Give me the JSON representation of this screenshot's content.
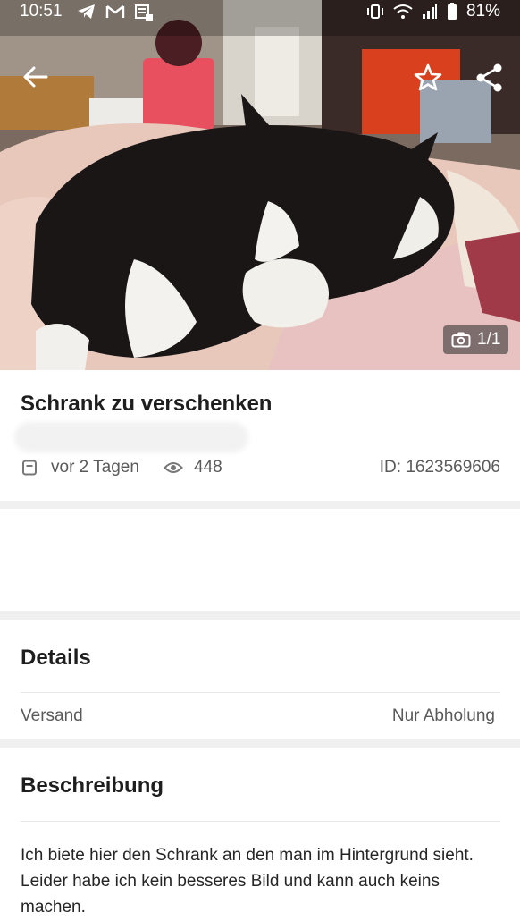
{
  "status_bar": {
    "time": "10:51",
    "left_icons": [
      "telegram-icon",
      "gmail-icon",
      "news-icon"
    ],
    "right_icons": [
      "vibrate-icon",
      "wifi-icon",
      "signal-icon",
      "battery-icon"
    ],
    "battery": "81%"
  },
  "photo": {
    "counter": "1/1"
  },
  "listing": {
    "title": "Schrank zu verschenken",
    "date": "vor 2 Tagen",
    "views": "448",
    "id_label": "ID: 1623569606"
  },
  "details": {
    "heading": "Details",
    "rows": [
      {
        "key": "Versand",
        "value": "Nur Abholung"
      }
    ]
  },
  "description": {
    "heading": "Beschreibung",
    "text": "Ich biete hier den Schrank an den man im Hintergrund sieht. Leider habe ich kein besseres Bild und kann auch keins machen."
  },
  "colors": {
    "page_background": "#ffffff",
    "section_gap": "#f0f0f0",
    "heading_text": "#1e1e1e",
    "meta_text": "#5a5a5a"
  }
}
